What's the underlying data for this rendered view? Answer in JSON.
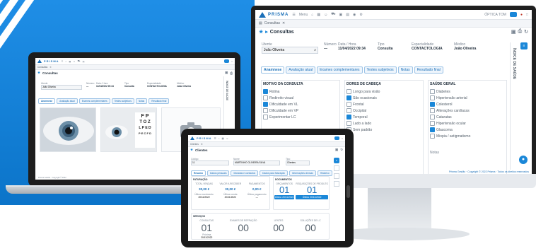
{
  "app": {
    "brand": "PRISMA",
    "menu_label": "Menu"
  },
  "colors": {
    "accent": "#1a87d8",
    "brand_blue": "#0b74c9"
  },
  "desktop": {
    "breadcrumb": "Consultas",
    "page_title": "Consultas",
    "header": {
      "patient_label": "Utente",
      "patient_value": "João Oliveira",
      "number_label": "Número",
      "number_value": "—",
      "date_label": "Data / Hora",
      "date_value": "11/04/2022 09:34",
      "type_label": "Tipo",
      "type_value": "Consulta",
      "specialty_label": "Especialidade",
      "specialty_value": "CONTACTOLOGIA",
      "doctor_label": "Médico",
      "doctor_value": "João Oliveira"
    },
    "tabs": [
      "Anamnese",
      "Avaliação atual",
      "Exames complementares",
      "Testes subjetivos",
      "Notas",
      "Resultado final"
    ],
    "columns": [
      {
        "title": "MOTIVO DA CONSULTA",
        "options": [
          {
            "label": "Rotina",
            "checked": true
          },
          {
            "label": "Redireito visual",
            "checked": false
          },
          {
            "label": "Dificuldade em VL",
            "checked": true
          },
          {
            "label": "Dificuldade em VP",
            "checked": false
          },
          {
            "label": "Experimentar LC",
            "checked": false
          }
        ]
      },
      {
        "title": "DORES DE CABEÇA",
        "options": [
          {
            "label": "Longo para visão",
            "checked": false
          },
          {
            "label": "São ocasionais",
            "checked": true
          },
          {
            "label": "Frontal",
            "checked": false
          },
          {
            "label": "Occipital",
            "checked": false
          },
          {
            "label": "Temporal",
            "checked": true
          },
          {
            "label": "Lado a lado",
            "checked": false
          },
          {
            "label": "Sem padrão",
            "checked": false
          }
        ]
      },
      {
        "title": "SAÚDE GERAL",
        "options": [
          {
            "label": "Diabetes",
            "checked": false
          },
          {
            "label": "Hipertensão arterial",
            "checked": false
          },
          {
            "label": "Colesterol",
            "checked": true
          },
          {
            "label": "Alterações cardíacas",
            "checked": false
          },
          {
            "label": "Cataratas",
            "checked": false
          },
          {
            "label": "Hipertensão ocular",
            "checked": false
          },
          {
            "label": "Glaucoma",
            "checked": true
          },
          {
            "label": "Miopia / astigmatismo",
            "checked": false
          }
        ]
      }
    ],
    "side_label": "ÍNDICE DE SAÚDE",
    "notes_label": "Notas",
    "user_menu": "ÓPTICA TOM",
    "footer": "Prisma Gestão · Copyright © 2022 Prisma · Todos os direitos reservados"
  },
  "laptop": {
    "breadcrumb": "Consultas",
    "page_title": "Consultas",
    "header": {
      "patient_label": "Utente",
      "patient_value": "João Oliveira",
      "number_label": "Número",
      "number_value": "—",
      "date_label": "Data / Hora",
      "date_value": "11/04/2022 09:34",
      "type_label": "Tipo",
      "type_value": "Consulta",
      "specialty_label": "Especialidade",
      "specialty_value": "CONTACTOLOGIA",
      "doctor_label": "Médico",
      "doctor_value": "João Oliveira"
    },
    "tabs": [
      "Anamnese",
      "Avaliação atual",
      "Exames complementares",
      "Testes subjetivos",
      "Notas",
      "Resultado final"
    ],
    "eye_chart": [
      "F P",
      "T O Z",
      "L P E D",
      "P E C F D"
    ],
    "side_label": "ÍNDICE DE SAÚDE",
    "footer": "Prisma Gestão · Copyright © 2022"
  },
  "tablet": {
    "breadcrumb": "Clientes",
    "page_title": "Clientes",
    "header": {
      "code_label": "Código",
      "code_value": "11",
      "name_label": "Nome",
      "name_value": "MARTINHO OLIVEIRA SILVA",
      "type_label": "Tipo",
      "type_value": "Clientes"
    },
    "tabs": [
      "Resumo",
      "Dados pessoais",
      "Moradas e contactos",
      "Dados para faturação",
      "Informações clínicas",
      "Histórico"
    ],
    "sales": {
      "title": "FATURAÇÃO",
      "labels": [
        "TOTAL VENDAS",
        "VALOR A RECEBER",
        "PAGAMENTOS"
      ],
      "values": [
        "30,00 €",
        "30,00 €",
        "0,00 €"
      ],
      "sub_labels": [
        "Último movimento",
        "Última venda",
        "Último pagamento"
      ],
      "sub_values": [
        "20/11/2022",
        "20/11/2022",
        "—"
      ]
    },
    "documents": {
      "title": "DOCUMENTOS",
      "labels": [
        "ORÇAMENTOS",
        "REQUISIÇÕES DE PRODUTO"
      ],
      "values": [
        "01",
        "01"
      ],
      "sub_labels": [
        "Último",
        "Último"
      ],
      "sub_values": [
        "20/11/2022",
        "20/11/2022"
      ]
    },
    "services": {
      "title": "SERVIÇOS",
      "labels": [
        "CONSULTAS",
        "EXAMES DE REFRAÇÃO",
        "LENTES",
        "SOLUÇÕES DE LC"
      ],
      "values": [
        "01",
        "00",
        "00",
        "00"
      ],
      "sub_labels": [
        "Próxima",
        "",
        "",
        ""
      ],
      "sub_values": [
        "20/11/2022",
        "",
        "",
        ""
      ]
    }
  }
}
